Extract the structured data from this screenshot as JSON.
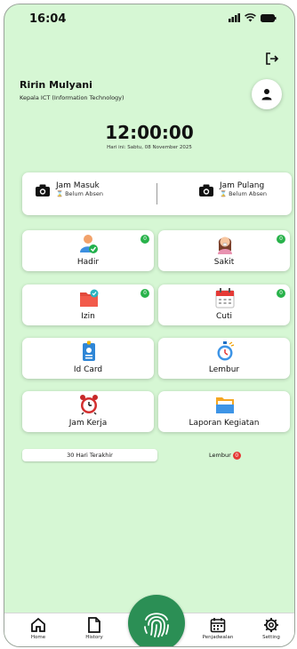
{
  "status_bar": {
    "time": "16:04",
    "icons": [
      "signal-icon",
      "wifi-icon",
      "battery-icon"
    ]
  },
  "header": {
    "user_name": "Ririn Mulyani",
    "user_role": "Kepala ICT (Information Technology)",
    "logout_icon": "logout-icon",
    "profile_icon": "person-icon"
  },
  "clock": {
    "time": "12:00:00",
    "date": "Hari ini: Sabtu, 08 November 2025"
  },
  "attendance": {
    "in": {
      "title": "Jam Masuk",
      "status": "Belum Absen",
      "icon": "camera-icon"
    },
    "out": {
      "title": "Jam Pulang",
      "status": "Belum Absen",
      "icon": "camera-icon"
    }
  },
  "menu": [
    {
      "label": "Hadir",
      "badge": "0",
      "icon": "person-check-icon"
    },
    {
      "label": "Sakit",
      "badge": "0",
      "icon": "sick-person-icon"
    },
    {
      "label": "Izin",
      "badge": "0",
      "icon": "folder-check-icon"
    },
    {
      "label": "Cuti",
      "badge": "0",
      "icon": "calendar-icon"
    },
    {
      "label": "Id Card",
      "icon": "id-card-icon"
    },
    {
      "label": "Lembur",
      "icon": "stopwatch-icon"
    },
    {
      "label": "Jam Kerja",
      "icon": "alarm-clock-icon"
    },
    {
      "label": "Laporan Kegiatan",
      "icon": "folder-icon"
    }
  ],
  "filter": {
    "period": "30 Hari Terakhir",
    "lembur_label": "Lembur",
    "lembur_badge": "0"
  },
  "colors": {
    "background": "#d6f7d4",
    "accent": "#2b8f55",
    "badge_green": "#28b24a",
    "badge_red": "#e53935"
  },
  "bottom_nav": [
    {
      "label": "Home",
      "icon": "home-icon"
    },
    {
      "label": "History",
      "icon": "document-icon"
    },
    {
      "label": "Penjadwalan",
      "icon": "calendar-grid-icon"
    },
    {
      "label": "Setting",
      "icon": "gear-icon"
    }
  ],
  "fab": {
    "icon": "fingerprint-icon"
  }
}
